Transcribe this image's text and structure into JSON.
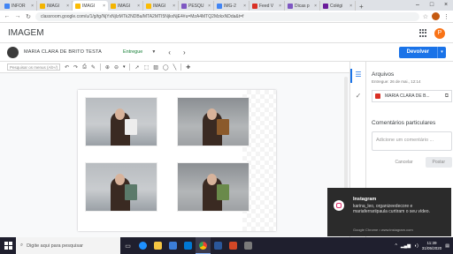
{
  "browser": {
    "tabs": [
      {
        "label": "INFOR",
        "color": "#4285f4"
      },
      {
        "label": "IMAGI",
        "color": "#f4b400"
      },
      {
        "label": "IMAGI",
        "color": "#fbbc04",
        "active": true
      },
      {
        "label": "IMAGI",
        "color": "#f4b400"
      },
      {
        "label": "IMAGI",
        "color": "#fbbc04"
      },
      {
        "label": "PESQU",
        "color": "#7e57c2"
      },
      {
        "label": "IMG-2",
        "color": "#4285f4"
      },
      {
        "label": "Feed V",
        "color": "#d93025"
      },
      {
        "label": "Dicas p",
        "color": "#7e57c2"
      },
      {
        "label": "Colégi",
        "color": "#6a1b9a"
      }
    ],
    "url": "classroom.google.com/u/1/g/tg/NjYxNjIzMTk2NDBa/MTA2MTI5NjkxNjE4#u=MzA4MTQ2MzkxNDda&t=f"
  },
  "app": {
    "title": "IMAGEM",
    "profile_initial": "P"
  },
  "student": {
    "name": "MARIA CLARA DE BRITO TESTA",
    "status": "Entregue",
    "return_label": "Devolver"
  },
  "toolbar": {
    "search_placeholder": "Pesquisar os menus (Alt+/)",
    "selection_tool": "▾"
  },
  "document": {
    "photos": [
      {
        "book_color": "#ededed"
      },
      {
        "book_color": "#8b5a2b"
      },
      {
        "book_color": "#5b7a6a"
      },
      {
        "book_color": "#6a8a4a"
      }
    ]
  },
  "panel": {
    "files_heading": "Arquivos",
    "submitted": "Entregue: 26 de mai., 12:14",
    "file_name": "MARIA CLARA DE B...",
    "comments_heading": "Comentários particulares",
    "comment_placeholder": "Adicione um comentário ...",
    "cancel_label": "Cancelar",
    "post_label": "Postar"
  },
  "notification": {
    "title": "Instagram",
    "body": "karina_leo, organizeedecore e mariaferrariipaula curtiram o seu vídeo.",
    "source": "Google Chrome • www.instagram.com"
  },
  "taskbar": {
    "search_placeholder": "Digite aqui para pesquisar",
    "time": "11:39",
    "date": "31/05/2020"
  },
  "colors": {
    "accent": "#1a73e8",
    "status_green": "#188038",
    "taskbar": "#1f1f2e"
  }
}
